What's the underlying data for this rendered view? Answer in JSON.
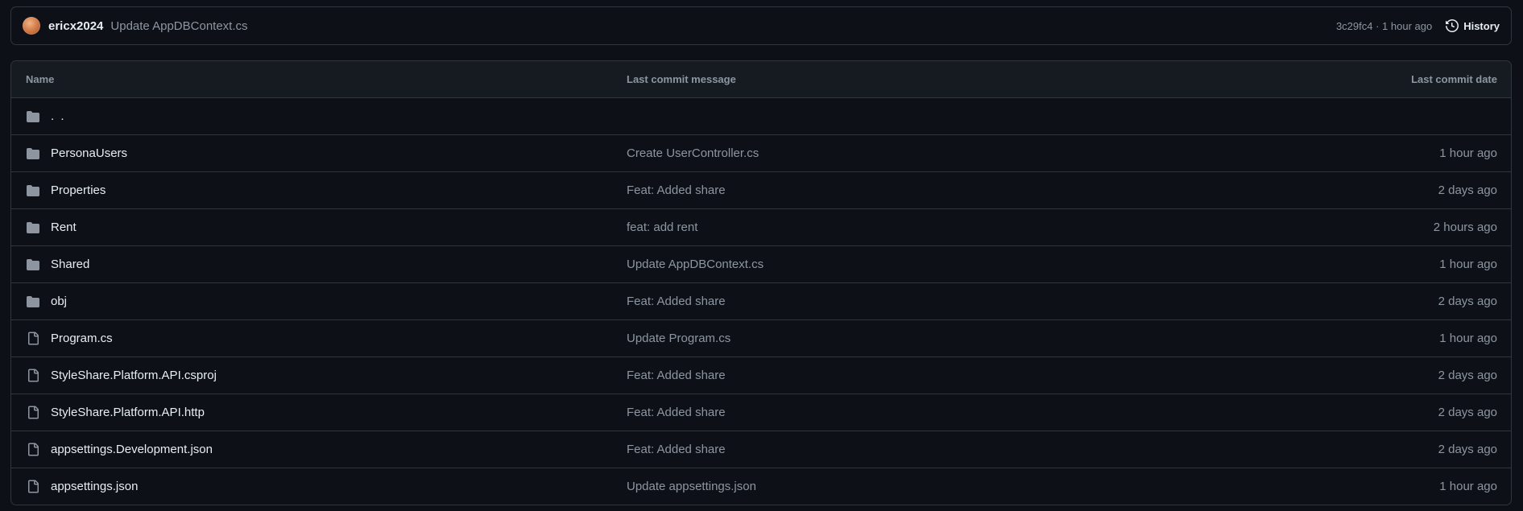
{
  "latest_commit": {
    "author": "ericx2024",
    "message": "Update AppDBContext.cs",
    "meta": "3c29fc4 · 1 hour ago",
    "history_label": "History"
  },
  "table": {
    "headers": {
      "name": "Name",
      "message": "Last commit message",
      "date": "Last commit date"
    },
    "parent": {
      "name": ". ."
    },
    "rows": [
      {
        "type": "folder",
        "name": "PersonaUsers",
        "message": "Create UserController.cs",
        "date": "1 hour ago"
      },
      {
        "type": "folder",
        "name": "Properties",
        "message": "Feat: Added share",
        "date": "2 days ago"
      },
      {
        "type": "folder",
        "name": "Rent",
        "message": "feat: add rent",
        "date": "2 hours ago"
      },
      {
        "type": "folder",
        "name": "Shared",
        "message": "Update AppDBContext.cs",
        "date": "1 hour ago"
      },
      {
        "type": "folder",
        "name": "obj",
        "message": "Feat: Added share",
        "date": "2 days ago"
      },
      {
        "type": "file",
        "name": "Program.cs",
        "message": "Update Program.cs",
        "date": "1 hour ago"
      },
      {
        "type": "file",
        "name": "StyleShare.Platform.API.csproj",
        "message": "Feat: Added share",
        "date": "2 days ago"
      },
      {
        "type": "file",
        "name": "StyleShare.Platform.API.http",
        "message": "Feat: Added share",
        "date": "2 days ago"
      },
      {
        "type": "file",
        "name": "appsettings.Development.json",
        "message": "Feat: Added share",
        "date": "2 days ago"
      },
      {
        "type": "file",
        "name": "appsettings.json",
        "message": "Update appsettings.json",
        "date": "1 hour ago"
      }
    ]
  },
  "colors": {
    "background": "#0d1117",
    "border": "#30363d",
    "header_bg": "#161b22",
    "text_primary": "#e6edf3",
    "text_muted": "#8d96a0",
    "icon": "#8d96a0"
  }
}
